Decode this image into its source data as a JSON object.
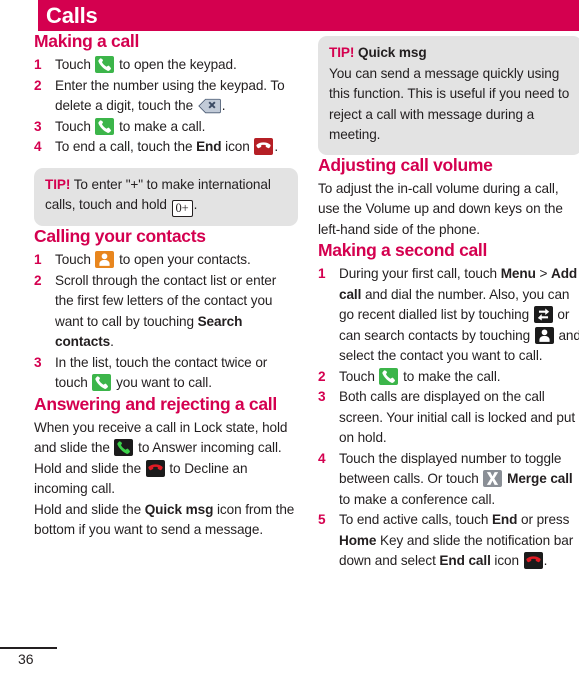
{
  "header": {
    "title": "Calls",
    "bar_color": "#d4004f"
  },
  "colors": {
    "accent": "#d4004f",
    "body_text": "#231f20",
    "tip_bg": "#e3e3e3",
    "icon_green": "#3cb54a",
    "icon_dark": "#1b1b1b",
    "icon_orange": "#e8861e",
    "icon_red": "#b51f25",
    "icon_gray_blue": "#6e7b8b",
    "icon_merge_gray": "#8a8f96"
  },
  "left_column": {
    "section_making_a_call": {
      "heading": "Making a call",
      "steps": [
        {
          "num": "1",
          "parts": [
            {
              "t": "text",
              "v": "Touch "
            },
            {
              "t": "icon",
              "v": "phone-call-green-icon"
            },
            {
              "t": "text",
              "v": " to open the keypad."
            }
          ]
        },
        {
          "num": "2",
          "parts": [
            {
              "t": "text",
              "v": "Enter the number using the keypad. To delete a digit, touch the "
            },
            {
              "t": "icon",
              "v": "backspace-icon"
            },
            {
              "t": "text",
              "v": "."
            }
          ]
        },
        {
          "num": "3",
          "parts": [
            {
              "t": "text",
              "v": "Touch "
            },
            {
              "t": "icon",
              "v": "phone-call-green-icon"
            },
            {
              "t": "text",
              "v": " to make a call."
            }
          ]
        },
        {
          "num": "4",
          "parts": [
            {
              "t": "text",
              "v": "To end a call, touch the "
            },
            {
              "t": "bold",
              "v": "End"
            },
            {
              "t": "text",
              "v": " icon "
            },
            {
              "t": "icon",
              "v": "end-call-red-icon"
            },
            {
              "t": "text",
              "v": "."
            }
          ]
        }
      ]
    },
    "tip_plus": {
      "label": "TIP!",
      "parts": [
        {
          "t": "text",
          "v": " To enter \"+\" to make international calls, touch and hold "
        },
        {
          "t": "key",
          "v": "0+"
        },
        {
          "t": "text",
          "v": "."
        }
      ]
    },
    "section_calling_contacts": {
      "heading": "Calling your contacts",
      "steps": [
        {
          "num": "1",
          "parts": [
            {
              "t": "text",
              "v": "Touch "
            },
            {
              "t": "icon",
              "v": "contacts-orange-icon"
            },
            {
              "t": "text",
              "v": " to open your contacts."
            }
          ]
        },
        {
          "num": "2",
          "parts": [
            {
              "t": "text",
              "v": "Scroll through the contact list or enter the first few letters of the contact you want to call by touching "
            },
            {
              "t": "bold",
              "v": "Search contacts"
            },
            {
              "t": "text",
              "v": "."
            }
          ]
        },
        {
          "num": "3",
          "parts": [
            {
              "t": "text",
              "v": "In the list, touch the contact twice or touch "
            },
            {
              "t": "icon",
              "v": "phone-call-green-small-icon"
            },
            {
              "t": "text",
              "v": " you want to call."
            }
          ]
        }
      ]
    },
    "section_answering": {
      "heading": "Answering and rejecting a call",
      "paragraphs": [
        {
          "parts": [
            {
              "t": "text",
              "v": "When you receive a call in Lock state, hold and slide the "
            },
            {
              "t": "icon",
              "v": "answer-call-dark-icon"
            },
            {
              "t": "text",
              "v": " to Answer incoming call."
            }
          ]
        },
        {
          "parts": [
            {
              "t": "text",
              "v": "Hold and slide the "
            },
            {
              "t": "icon",
              "v": "decline-call-dark-icon"
            },
            {
              "t": "text",
              "v": " to Decline an incoming call."
            }
          ]
        },
        {
          "parts": [
            {
              "t": "text",
              "v": "Hold and slide the "
            },
            {
              "t": "bold",
              "v": "Quick msg"
            },
            {
              "t": "text",
              "v": " icon from the bottom if you want to send a message."
            }
          ]
        }
      ]
    }
  },
  "right_column": {
    "tip_quick_msg": {
      "label": "TIP!",
      "title": "Quick msg",
      "body": "You can send a message quickly using this function. This is useful if you need to reject a call with message during a meeting."
    },
    "section_volume": {
      "heading": "Adjusting call volume",
      "body": "To adjust the in-call volume during a call, use the Volume up and down keys on the left-hand side of the phone."
    },
    "section_second_call": {
      "heading": "Making a second call",
      "steps": [
        {
          "num": "1",
          "parts": [
            {
              "t": "text",
              "v": "During your first call, touch "
            },
            {
              "t": "bold",
              "v": "Menu"
            },
            {
              "t": "text",
              "v": " > "
            },
            {
              "t": "bold",
              "v": "Add call"
            },
            {
              "t": "text",
              "v": " and dial the number. Also, you can go recent dialled list by touching "
            },
            {
              "t": "icon",
              "v": "recent-calls-dark-icon"
            },
            {
              "t": "text",
              "v": " or can search contacts by touching "
            },
            {
              "t": "icon",
              "v": "contacts-dark-icon"
            },
            {
              "t": "text",
              "v": " and select the contact you want to call."
            }
          ]
        },
        {
          "num": "2",
          "parts": [
            {
              "t": "text",
              "v": "Touch "
            },
            {
              "t": "icon",
              "v": "phone-call-green-icon"
            },
            {
              "t": "text",
              "v": " to make the call."
            }
          ]
        },
        {
          "num": "3",
          "parts": [
            {
              "t": "text",
              "v": "Both calls are displayed on the call screen. Your initial call is locked and put on hold."
            }
          ]
        },
        {
          "num": "4",
          "parts": [
            {
              "t": "text",
              "v": "Touch the displayed number to toggle between calls. Or touch "
            },
            {
              "t": "icon",
              "v": "merge-call-icon"
            },
            {
              "t": "text",
              "v": " "
            },
            {
              "t": "bold",
              "v": "Merge call"
            },
            {
              "t": "text",
              "v": " to make a conference call."
            }
          ]
        },
        {
          "num": "5",
          "parts": [
            {
              "t": "text",
              "v": "To end active calls, touch "
            },
            {
              "t": "bold",
              "v": "End"
            },
            {
              "t": "text",
              "v": " or press "
            },
            {
              "t": "bold",
              "v": "Home"
            },
            {
              "t": "text",
              "v": " Key and slide the notification bar down and select "
            },
            {
              "t": "bold",
              "v": "End call"
            },
            {
              "t": "text",
              "v": " icon "
            },
            {
              "t": "icon",
              "v": "end-call-dark-icon"
            },
            {
              "t": "text",
              "v": "."
            }
          ]
        }
      ]
    }
  },
  "footer": {
    "page_number": "36"
  }
}
